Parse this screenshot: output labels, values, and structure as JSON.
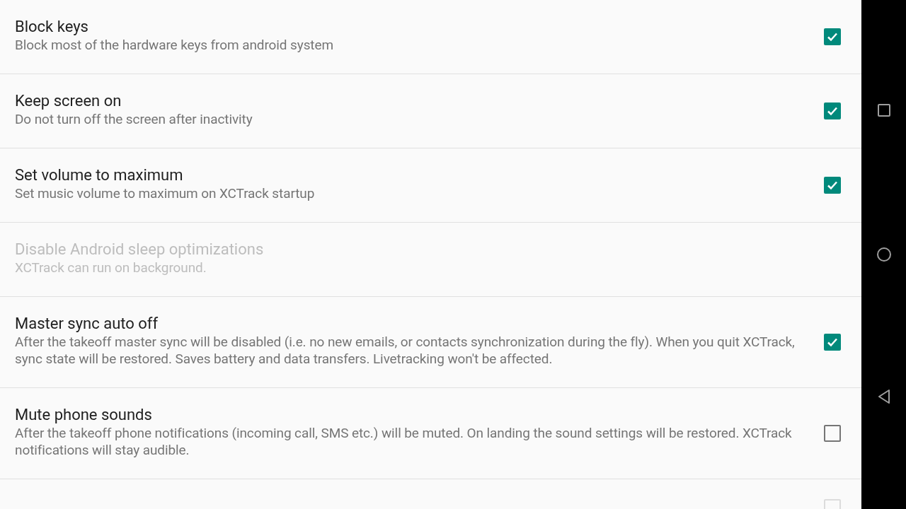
{
  "settings": [
    {
      "kind": "checkbox",
      "title": "Block keys",
      "summary": "Block most of the hardware keys from android system",
      "checked": true,
      "disabled": false
    },
    {
      "kind": "checkbox",
      "title": "Keep screen on",
      "summary": "Do not turn off the screen after inactivity",
      "checked": true,
      "disabled": false
    },
    {
      "kind": "checkbox",
      "title": "Set volume to maximum",
      "summary": "Set music volume to maximum on XCTrack startup",
      "checked": true,
      "disabled": false
    },
    {
      "kind": "text",
      "title": "Disable Android sleep optimizations",
      "summary": "XCTrack can run on background.",
      "disabled": true
    },
    {
      "kind": "checkbox",
      "title": "Master sync auto off",
      "summary": "After the takeoff master sync will be disabled (i.e. no new emails, or contacts synchronization during the fly). When you quit XCTrack, sync state will be restored. Saves battery and data transfers. Livetracking won't be affected.",
      "checked": true,
      "disabled": false
    },
    {
      "kind": "checkbox",
      "title": "Mute phone sounds",
      "summary": "After the takeoff phone notifications (incoming call, SMS etc.) will be muted. On landing the sound settings will be restored. XCTrack notifications will stay audible.",
      "checked": false,
      "disabled": false
    },
    {
      "kind": "checkbox",
      "checked": false,
      "disabled": true
    }
  ]
}
